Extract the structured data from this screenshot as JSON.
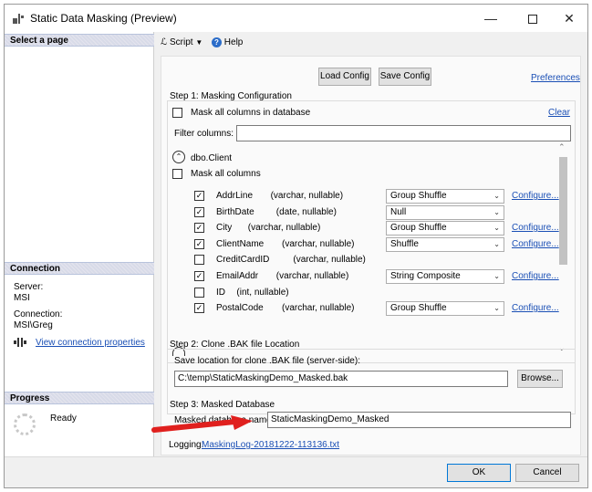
{
  "window": {
    "title": "Static Data Masking (Preview)",
    "minimize": "—",
    "close": "✕"
  },
  "sidebar": {
    "select_page": "Select a page",
    "connection_header": "Connection",
    "server_label": "Server:",
    "server_value": "MSI",
    "connection_label": "Connection:",
    "connection_value": "MSI\\Greg",
    "view_connection_link": "View connection properties",
    "progress_header": "Progress",
    "progress_status": "Ready"
  },
  "toolbar": {
    "script_label": "Script",
    "help_label": "Help"
  },
  "config": {
    "load_label": "Load Config",
    "save_label": "Save Config",
    "preferences_link": "Preferences"
  },
  "step1": {
    "label": "Step 1: Masking Configuration",
    "mask_all_db": "Mask all columns in database",
    "clear_link": "Clear",
    "filter_label": "Filter columns:",
    "filter_value": "",
    "table_name": "dbo.Client",
    "mask_all_columns": "Mask all columns",
    "columns": [
      {
        "name": "AddrLine",
        "type": "(varchar, nullable)",
        "checked": true,
        "function": "Group Shuffle",
        "has_configure": true,
        "configure": "Configure..."
      },
      {
        "name": "BirthDate",
        "type": "(date, nullable)",
        "checked": true,
        "function": "Null",
        "has_configure": false,
        "configure": ""
      },
      {
        "name": "City",
        "type": "(varchar, nullable)",
        "checked": true,
        "function": "Group Shuffle",
        "has_configure": true,
        "configure": "Configure..."
      },
      {
        "name": "ClientName",
        "type": "(varchar, nullable)",
        "checked": true,
        "function": "Shuffle",
        "has_configure": true,
        "configure": "Configure..."
      },
      {
        "name": "CreditCardID",
        "type": "(varchar, nullable)",
        "checked": false,
        "function": "",
        "has_configure": false,
        "configure": ""
      },
      {
        "name": "EmailAddr",
        "type": "(varchar, nullable)",
        "checked": true,
        "function": "String Composite",
        "has_configure": true,
        "configure": "Configure..."
      },
      {
        "name": "ID",
        "type": "(int, nullable)",
        "checked": false,
        "function": "",
        "has_configure": false,
        "configure": ""
      },
      {
        "name": "PostalCode",
        "type": "(varchar, nullable)",
        "checked": true,
        "function": "Group Shuffle",
        "has_configure": true,
        "configure": "Configure..."
      }
    ]
  },
  "step2": {
    "label": "Step 2: Clone .BAK file Location",
    "save_location_label": "Save location for clone .BAK file (server-side):",
    "path_value": "C:\\temp\\StaticMaskingDemo_Masked.bak",
    "browse_label": "Browse..."
  },
  "step3": {
    "label": "Step 3: Masked Database",
    "name_label": "Masked database name:",
    "name_value": "StaticMaskingDemo_Masked"
  },
  "logging": {
    "label": "Logging:",
    "link": "MaskingLog-20181222-113136.txt"
  },
  "footer": {
    "ok_label": "OK",
    "cancel_label": "Cancel"
  },
  "colors": {
    "link": "#1a4fb5",
    "arrow": "#e0201e",
    "focus": "#0078d7"
  }
}
